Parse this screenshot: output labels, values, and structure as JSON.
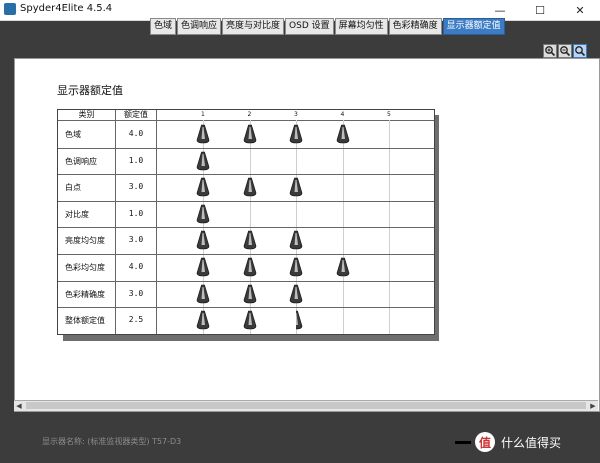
{
  "window": {
    "title": "Spyder4Elite 4.5.4",
    "minimize": "—",
    "maximize": "☐",
    "close": "✕"
  },
  "tabs": [
    {
      "label": "色域",
      "active": false
    },
    {
      "label": "色调响应",
      "active": false
    },
    {
      "label": "亮度与对比度",
      "active": false
    },
    {
      "label": "OSD 设置",
      "active": false
    },
    {
      "label": "屏幕均匀性",
      "active": false
    },
    {
      "label": "色彩精确度",
      "active": false
    },
    {
      "label": "显示器额定值",
      "active": true
    }
  ],
  "zoom": {
    "in_icon": "zoom-in-icon",
    "out_icon": "zoom-out-icon",
    "fit_icon": "zoom-fit-icon"
  },
  "report": {
    "title": "显示器额定值"
  },
  "table": {
    "headers": {
      "category": "类别",
      "rating": "额定值"
    },
    "scale_ticks": [
      "1",
      "2",
      "3",
      "4",
      "5"
    ],
    "rows": [
      {
        "category": "色域",
        "rating": "4.0",
        "value": 4.0
      },
      {
        "category": "色调响应",
        "rating": "1.0",
        "value": 1.0
      },
      {
        "category": "白点",
        "rating": "3.0",
        "value": 3.0
      },
      {
        "category": "对比度",
        "rating": "1.0",
        "value": 1.0
      },
      {
        "category": "亮度均匀度",
        "rating": "3.0",
        "value": 3.0
      },
      {
        "category": "色彩均匀度",
        "rating": "4.0",
        "value": 4.0
      },
      {
        "category": "色彩精确度",
        "rating": "3.0",
        "value": 3.0
      },
      {
        "category": "整体额定值",
        "rating": "2.5",
        "value": 2.5
      }
    ]
  },
  "status": {
    "text": "显示器名称: (标准监视器类型) T57-D3"
  },
  "watermark": {
    "logo": "值",
    "text": "什么值得买"
  },
  "colors": {
    "accent": "#3c7cc4",
    "background": "#3c3c3c"
  }
}
